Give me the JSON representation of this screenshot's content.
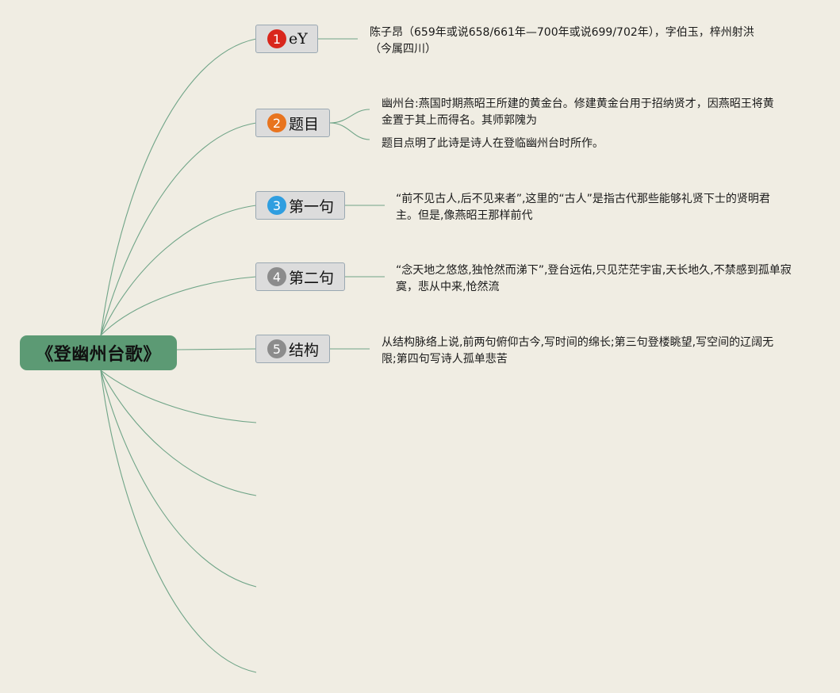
{
  "root": {
    "title": "《登幽州台歌》"
  },
  "nodes": [
    {
      "number": "1",
      "label": "eY",
      "badge_color": "#d9261c"
    },
    {
      "number": "2",
      "label": "题目",
      "badge_color": "#e8741f"
    },
    {
      "number": "3",
      "label": "第一句",
      "badge_color": "#2f9ee0"
    },
    {
      "number": "4",
      "label": "第二句",
      "badge_color": "#8c8c8c"
    },
    {
      "number": "5",
      "label": "结构",
      "badge_color": "#8c8c8c"
    }
  ],
  "notes": {
    "n1": "陈子昂（659年或说658/661年—700年或说699/702年），字伯玉，梓州射洪（今属四川）",
    "n2a": "幽州台:燕国时期燕昭王所建的黄金台。修建黄金台用于招纳贤才，因燕昭王将黄金置于其上而得名。其师郭隗为",
    "n2b": "题目点明了此诗是诗人在登临幽州台时所作。",
    "n3": "“前不见古人,后不见来者”,这里的“古人”是指古代那些能够礼贤下士的贤明君主。但是,像燕昭王那样前代",
    "n4": "“念天地之悠悠,独怆然而涕下”,登台远佑,只见茫茫宇宙,天长地久,不禁感到孤单寂寞，悲从中来,怆然流",
    "n5": "从结构脉络上说,前两句俯仰古今,写时间的绵长;第三句登楼眺望,写空间的辽阔无限;第四句写诗人孤单悲苦"
  },
  "colors": {
    "line": "#6fa487",
    "root_bg": "#5c9a74",
    "node_bg": "#dcdcdc"
  }
}
